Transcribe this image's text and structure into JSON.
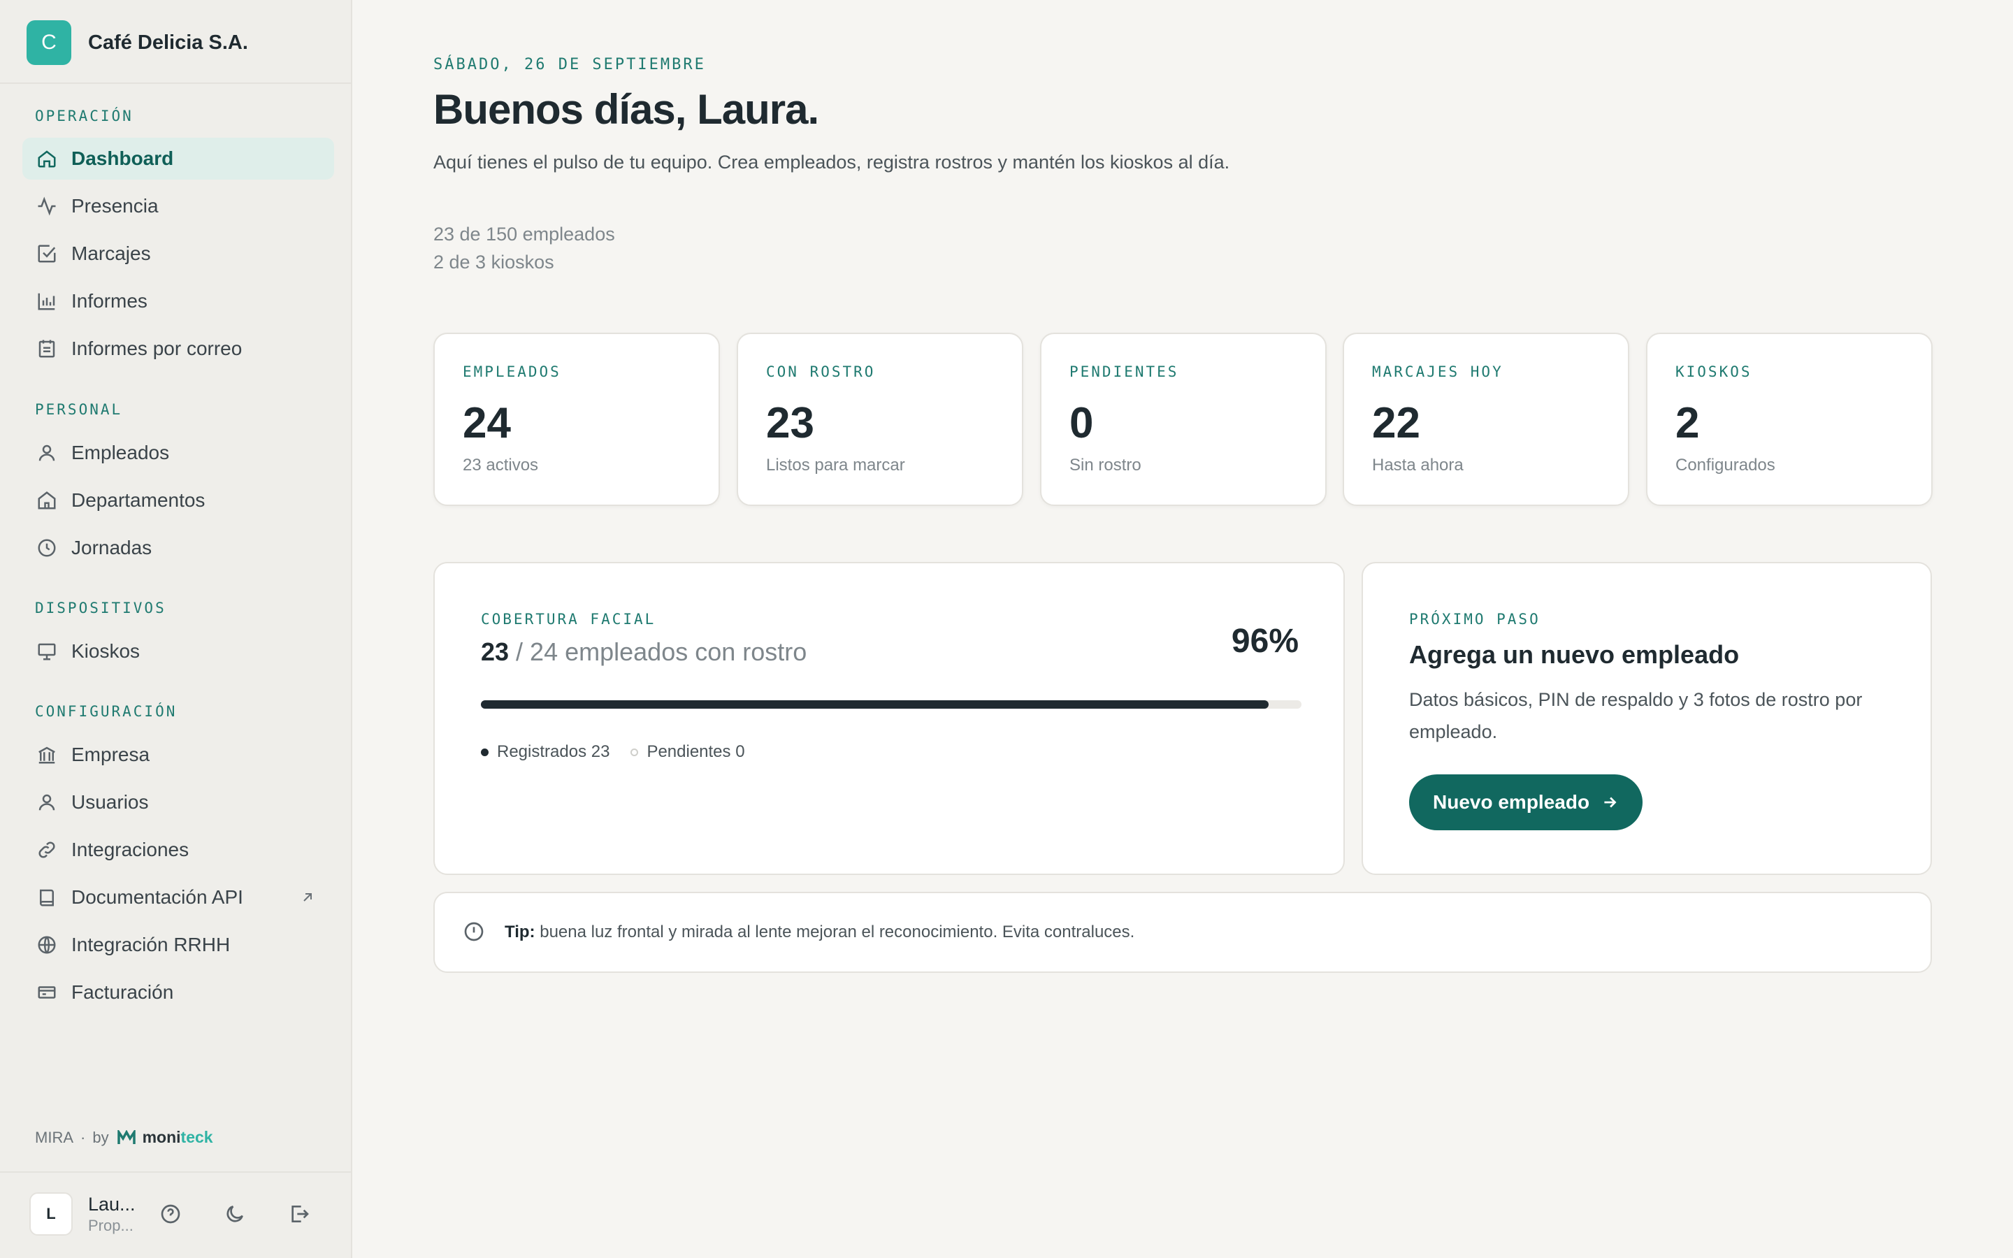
{
  "company": {
    "initial": "C",
    "name": "Café Delicia S.A."
  },
  "nav": {
    "sections": [
      {
        "title": "OPERACIÓN"
      },
      {
        "title": "PERSONAL"
      },
      {
        "title": "DISPOSITIVOS"
      },
      {
        "title": "CONFIGURACIÓN"
      }
    ],
    "items": [
      {
        "label": "Dashboard",
        "icon": "home-icon",
        "active": true
      },
      {
        "label": "Presencia",
        "icon": "activity-icon"
      },
      {
        "label": "Marcajes",
        "icon": "check-square-icon"
      },
      {
        "label": "Informes",
        "icon": "bar-chart-icon"
      },
      {
        "label": "Informes por correo",
        "icon": "calendar-list-icon"
      },
      {
        "label": "Empleados",
        "icon": "user-icon"
      },
      {
        "label": "Departamentos",
        "icon": "building-home-icon"
      },
      {
        "label": "Jornadas",
        "icon": "clock-icon"
      },
      {
        "label": "Kioskos",
        "icon": "monitor-icon"
      },
      {
        "label": "Empresa",
        "icon": "bank-icon"
      },
      {
        "label": "Usuarios",
        "icon": "user-icon"
      },
      {
        "label": "Integraciones",
        "icon": "link-icon"
      },
      {
        "label": "Documentación API",
        "icon": "book-icon",
        "external": true
      },
      {
        "label": "Integración RRHH",
        "icon": "globe-icon"
      },
      {
        "label": "Facturación",
        "icon": "credit-card-icon"
      }
    ]
  },
  "footer": {
    "product": "MIRA",
    "separator": "·",
    "by": "by",
    "vendor_a": "moni",
    "vendor_b": "teck"
  },
  "user": {
    "initial": "L",
    "name": "Lau...",
    "role": "Prop..."
  },
  "header": {
    "date": "SÁBADO, 26 DE SEPTIEMBRE",
    "greeting": "Buenos días, Laura.",
    "intro": "Aquí tienes el pulso de tu equipo. Crea empleados, registra rostros y mantén los kioskos al día.",
    "employees_quota": "23 de 150 empleados",
    "kiosks_quota": "2 de 3 kioskos"
  },
  "stats": [
    {
      "label": "EMPLEADOS",
      "value": "24",
      "sub": "23 activos"
    },
    {
      "label": "CON ROSTRO",
      "value": "23",
      "sub": "Listos para marcar"
    },
    {
      "label": "PENDIENTES",
      "value": "0",
      "sub": "Sin rostro"
    },
    {
      "label": "MARCAJES HOY",
      "value": "22",
      "sub": "Hasta ahora"
    },
    {
      "label": "KIOSKOS",
      "value": "2",
      "sub": "Configurados"
    }
  ],
  "coverage": {
    "label": "COBERTURA FACIAL",
    "count": "23",
    "rest": " / 24 empleados con rostro",
    "percent_label": "96%",
    "progress": 0.96,
    "legend_registered": "Registrados 23",
    "legend_pending": "Pendientes 0"
  },
  "next_step": {
    "label": "PRÓXIMO PASO",
    "title": "Agrega un nuevo empleado",
    "description": "Datos básicos, PIN de respaldo y 3 fotos de rostro por empleado.",
    "button": "Nuevo empleado"
  },
  "tip": {
    "prefix": "Tip:",
    "text": " buena luz frontal y mirada al lente mejoran el reconocimiento. Evita contraluces."
  },
  "colors": {
    "accent": "#11685f",
    "brand": "#2fb3a4",
    "background": "#f6f5f2"
  }
}
